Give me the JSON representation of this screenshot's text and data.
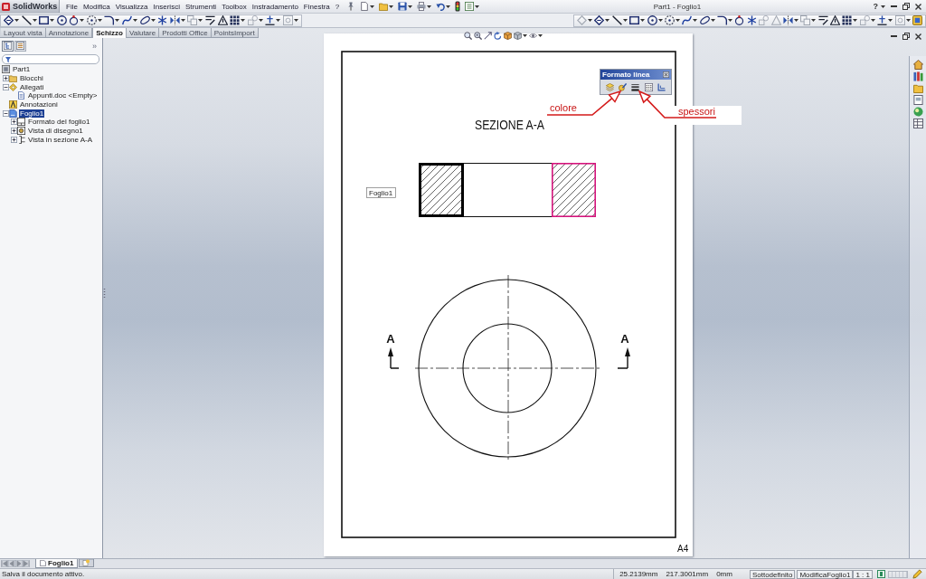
{
  "app": {
    "logo": "SolidWorks",
    "menu": [
      "File",
      "Modifica",
      "Visualizza",
      "Inserisci",
      "Strumenti",
      "Toolbox",
      "Instradamento",
      "Finestra",
      "?"
    ],
    "title": "Part1 - Foglio1",
    "help": "?"
  },
  "command_tabs": [
    {
      "label": "Layout vista",
      "selected": false
    },
    {
      "label": "Annotazione",
      "selected": false
    },
    {
      "label": "Schizzo",
      "selected": true
    },
    {
      "label": "Valutare",
      "selected": false
    },
    {
      "label": "Prodotti Office",
      "selected": false
    },
    {
      "label": "PointsImport",
      "selected": false
    }
  ],
  "feature_manager": {
    "panel_tabs": [
      {
        "kind": "feature-tree",
        "selected": true
      },
      {
        "kind": "properties",
        "selected": false
      }
    ],
    "expand": "»",
    "tree": [
      {
        "label": "Part1",
        "kind": "part",
        "selected": false,
        "children": [
          {
            "label": "Blocchi",
            "kind": "folder",
            "expanded": false,
            "selected": false
          },
          {
            "label": "Allegati",
            "kind": "attachments",
            "expanded": true,
            "selected": false,
            "children": [
              {
                "label": "Appunti.doc <Empty>",
                "kind": "document",
                "selected": false
              }
            ]
          },
          {
            "label": "Annotazioni",
            "kind": "annotations",
            "selected": false
          },
          {
            "label": "Foglio1",
            "kind": "sheet",
            "expanded": true,
            "selected": true,
            "children": [
              {
                "label": "Formato del foglio1",
                "kind": "sheet-format",
                "expanded": false,
                "selected": false
              },
              {
                "label": "Vista di disegno1",
                "kind": "drawing-view",
                "expanded": false,
                "selected": false
              },
              {
                "label": "Vista in sezione A-A",
                "kind": "section-view",
                "expanded": false,
                "selected": false
              }
            ]
          }
        ]
      }
    ]
  },
  "line_format_toolbar": {
    "title": "Formato linea"
  },
  "callouts": [
    {
      "text": "colore"
    },
    {
      "text": "spessori"
    }
  ],
  "drawing": {
    "view_title": "SEZIONE A-A",
    "sheet_label": "Foglio1",
    "section_faces": [
      {
        "kind": "thick",
        "color": "#000000"
      },
      {
        "kind": "thin",
        "color": "#d4157c"
      }
    ],
    "section_labels": [
      "A",
      "A"
    ],
    "sheet_size": "A4"
  },
  "sheet_tabs": [
    {
      "label": "Foglio1",
      "selected": true
    }
  ],
  "status_bar": {
    "message": "Salva il documento attivo.",
    "coordinates": [
      "25.2139mm",
      "217.3001mm",
      "0mm"
    ],
    "sketch_state": "Sottodefinito",
    "mode": "ModificaFoglio1",
    "scale": "1 : 1"
  }
}
